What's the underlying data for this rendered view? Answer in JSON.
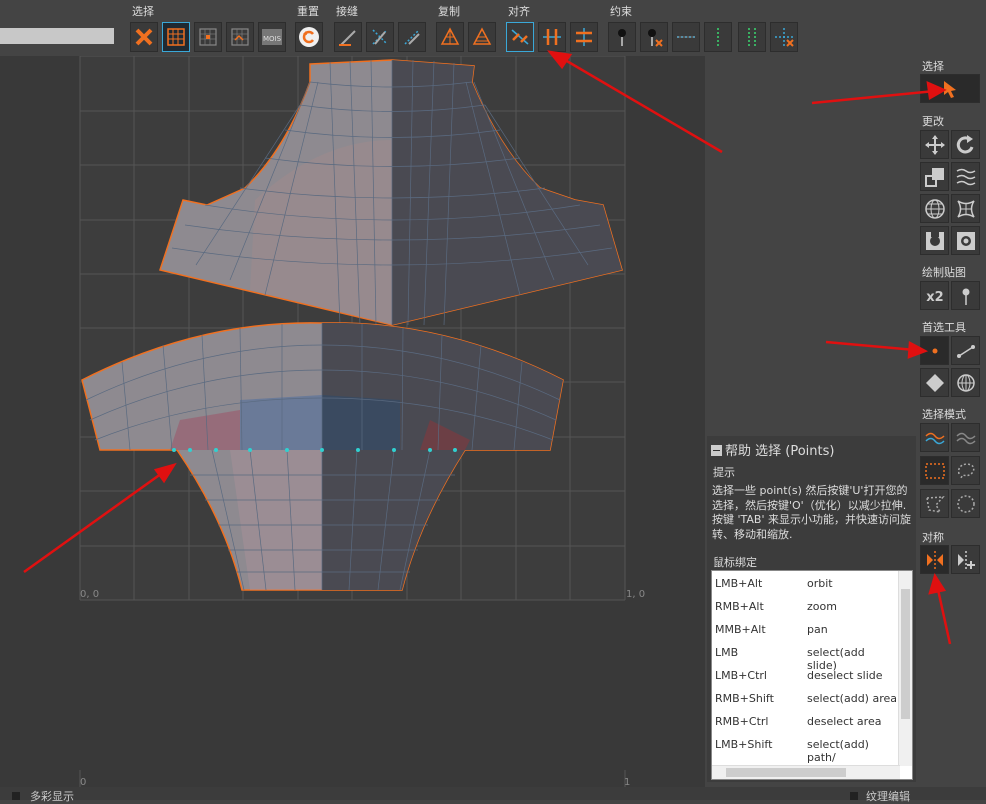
{
  "toolbar": {
    "groups": {
      "select": "选择",
      "reset": "重置",
      "stitch": "接缝",
      "copy": "复制",
      "align": "对齐",
      "constrain": "约束"
    }
  },
  "viewport": {
    "origin_label": "0, 0",
    "x_end_label": "1, 0",
    "bottom_left_label": "0",
    "bottom_right_label": "1"
  },
  "right_panel": {
    "select": "选择",
    "modify": "更改",
    "paint_texture": "绘制贴图",
    "preferred_tools": "首选工具",
    "select_mode": "选择模式",
    "symmetry": "对称"
  },
  "help": {
    "title": "帮助 选择 (Points)",
    "tip_heading": "提示",
    "tip_text": "选择一些 point(s) 然后按键'U'打开您的选择，然后按键'O'（优化）以减少拉伸. 按键 'TAB' 来显示小功能，并快速访问旋转、移动和缩放.",
    "bindings_heading": "鼠标绑定",
    "bindings": [
      {
        "key": "LMB+Alt",
        "action": "orbit"
      },
      {
        "key": "RMB+Alt",
        "action": "zoom"
      },
      {
        "key": "MMB+Alt",
        "action": "pan"
      },
      {
        "key": "LMB",
        "action": "select(add slide)"
      },
      {
        "key": "LMB+Ctrl",
        "action": "deselect slide"
      },
      {
        "key": "RMB+Shift",
        "action": "select(add) area"
      },
      {
        "key": "RMB+Ctrl",
        "action": "deselect area"
      },
      {
        "key": "LMB+Shift",
        "action": "select(add) path/"
      }
    ]
  },
  "statusbar": {
    "left_text": "多彩显示",
    "right_text": "纹理编辑"
  },
  "colors": {
    "accent_orange": "#f07020",
    "arrow_red": "#e01010",
    "selected_cyan": "#30d0d0"
  }
}
